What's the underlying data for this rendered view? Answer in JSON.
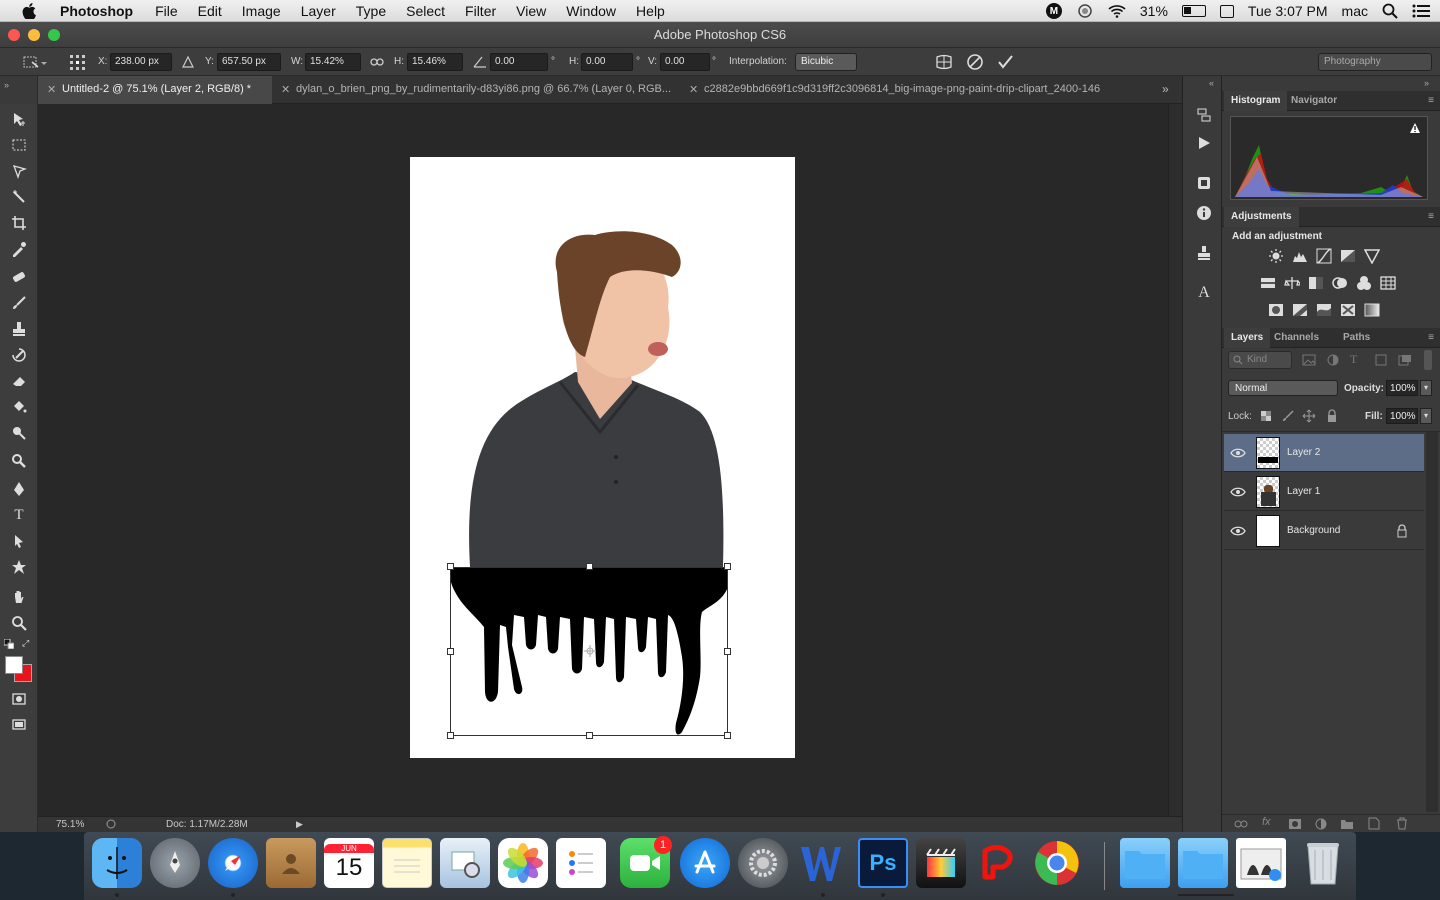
{
  "menubar": {
    "app_name": "Photoshop",
    "items": [
      "File",
      "Edit",
      "Image",
      "Layer",
      "Type",
      "Select",
      "Filter",
      "View",
      "Window",
      "Help"
    ],
    "battery": "31%",
    "clock": "Tue 3:07 PM",
    "user": "mac"
  },
  "window": {
    "title": "Adobe Photoshop CS6"
  },
  "options": {
    "x_label": "X:",
    "x_value": "238.00 px",
    "y_label": "Y:",
    "y_value": "657.50 px",
    "w_label": "W:",
    "w_value": "15.42%",
    "h_label": "H:",
    "h_value": "15.46%",
    "angle_value": "0.00",
    "hskew_label": "H:",
    "hskew_value": "0.00",
    "vskew_label": "V:",
    "vskew_value": "0.00",
    "degree": "°",
    "interp_label": "Interpolation:",
    "interp_value": "Bicubic",
    "workspace": "Photography"
  },
  "tabs": [
    {
      "label": "Untitled-2 @ 75.1% (Layer 2, RGB/8) *",
      "active": true
    },
    {
      "label": "dylan_o_brien_png_by_rudimentarily-d83yi86.png @ 66.7% (Layer 0, RGB...",
      "active": false
    },
    {
      "label": "c2882e9bbd669f1c9d319ff2c3096814_big-image-png-paint-drip-clipart_2400-146",
      "active": false
    }
  ],
  "status": {
    "zoom": "75.1%",
    "doc": "Doc: 1.17M/2.28M"
  },
  "histogram_panel": {
    "tabs": [
      "Histogram",
      "Navigator"
    ]
  },
  "adjustments_panel": {
    "title": "Adjustments",
    "subtitle": "Add an adjustment"
  },
  "layers_panel": {
    "tabs": [
      "Layers",
      "Channels",
      "Paths"
    ],
    "kind_filter": "Kind",
    "blend_mode": "Normal",
    "opacity_label": "Opacity:",
    "opacity_value": "100%",
    "lock_label": "Lock:",
    "fill_label": "Fill:",
    "fill_value": "100%",
    "layers": [
      {
        "name": "Layer 2",
        "selected": true
      },
      {
        "name": "Layer 1",
        "selected": false
      },
      {
        "name": "Background",
        "selected": false
      }
    ]
  },
  "dock": {
    "calendar_month": "JUN",
    "calendar_day": "15",
    "facetime_badge": "1"
  },
  "colors": {
    "foreground": "#ffffff",
    "background": "#e8141c",
    "selected_layer": "#5d6d88"
  }
}
